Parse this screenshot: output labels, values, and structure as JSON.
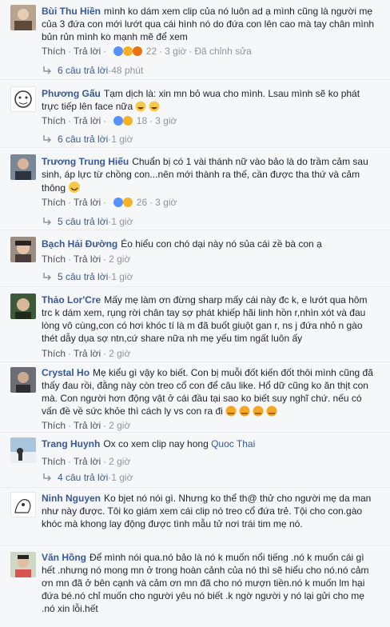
{
  "labels": {
    "like": "Thích",
    "reply": "Trả lời",
    "sep": "·"
  },
  "comments": [
    {
      "name": "Bùi Thu Hiền",
      "text": "mình ko dám xem clip của nó luôn ad ạ mình cũng là người mẹ của 3 đứa con mới lướt qua cái hình nó do đứa con lên cao mà tay chân mình bủn rủn mình ko mạnh mẽ để xem",
      "reactions": "22",
      "time": "3 giờ",
      "edited": "Đã chỉnh sửa",
      "replies": {
        "label": "6 câu trả lời",
        "time": "48 phút"
      }
    },
    {
      "name": "Phương Gấu",
      "text": "Tạm dịch là: xin mn bỏ wua cho mình. Lsau mình sẽ ko phát trực tiếp lên face nữa",
      "reactions": "18",
      "time": "3 giờ",
      "replies": {
        "label": "6 câu trả lời",
        "time": "1 giờ"
      }
    },
    {
      "name": "Trương Trung Hiếu",
      "text": "Chuẩn bị có 1 vài thánh nữ vào bảo là do trầm cảm sau sinh, áp lực từ chồng con...nên mới thành ra thế, cần được tha thứ và cảm thông",
      "reactions": "26",
      "time": "3 giờ",
      "replies": {
        "label": "5 câu trả lời",
        "time": "1 giờ"
      }
    },
    {
      "name": "Bạch Hải Đường",
      "text": "Éo hiểu con chó dại này nó sủa cái zề bà con ạ",
      "time": "2 giờ",
      "replies": {
        "label": "5 câu trả lời",
        "time": "1 giờ"
      }
    },
    {
      "name": "Thảo Lor'Cre",
      "text": "Mấy mẹ làm ơn đừng sharp mấy cái này đc k, e lướt qua hôm trc k dám xem, rụng rời chân tay sợ phát khiếp hãi linh hồn r,nhìn xót và đau lòng vô cùng,con có hơi khóc tí là m đã buốt giuột gan r, ns j đứa nhỏ n gào thét dẫy dụa sợ ntn,cứ share nữa nh mẹ yếu tim ngất luôn ấy",
      "time": "2 giờ"
    },
    {
      "name": "Crystal Ho",
      "text": "Mẹ kiểu gì vậy ko biết. Con bị muỗi đốt kiến đốt thôi mình cũng đã thấy đau rồi, đằng này còn treo cổ con để câu like. Hổ dữ cũng ko ăn thịt con mà. Con người hơn động vật ở cái đầu tại sao ko biết suy nghĩ chứ. nếu có vấn đề về sức khỏe thì cách ly vs con ra đi",
      "time": "2 giờ"
    },
    {
      "name": "Trang Huynh",
      "text": "Ox co xem clip nay hong",
      "tag": "Quoc Thai",
      "time": "2 giờ",
      "replies": {
        "label": "4 câu trả lời",
        "time": "1 giờ"
      }
    },
    {
      "name": "Ninh Nguyen",
      "text": "Ko bjet nó nói gì. Nhưng ko thể th@ thử cho người mẹ da man như này được. Tôi ko giám xem cái clip nó treo cổ đứa trẻ. Tội cho con.gào khóc mà khong lay động được tình mẫu tử nơi trái tim mẹ nó."
    },
    {
      "name": "Văn Hồng",
      "text": "Để mình nói qua.nó bảo là nó k muốn nổi tiếng .nó k muốn cái gì hết .nhưng nó mong mn ở trong hoàn cảnh của nó thì sẽ hiểu cho nó.nó cảm ơn mn đã ở bên cạnh và cảm ơn mn đã cho nó mượn tiền.nó k muốn lm hại đứa bé.nó chỉ muốn cho người yêu nó biết .k ngờ người y nó lại gửi cho mẹ .nó xin lỗi.hết"
    }
  ]
}
